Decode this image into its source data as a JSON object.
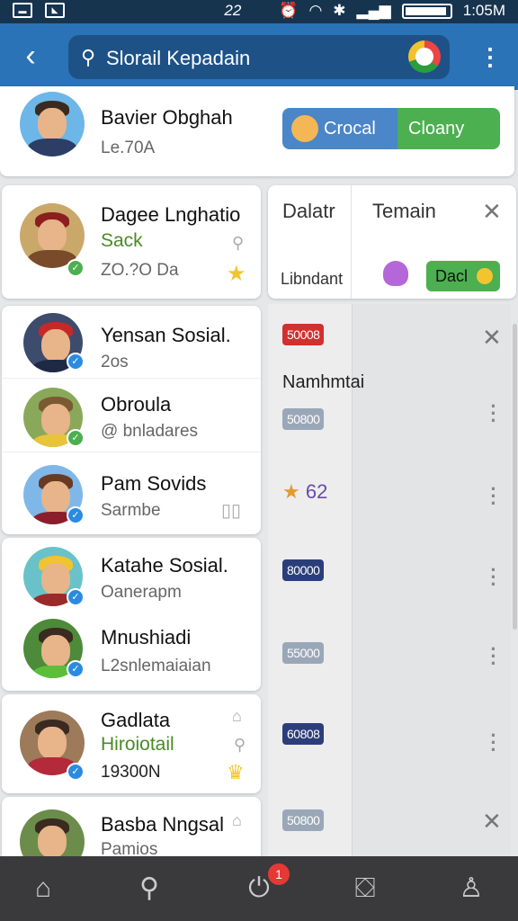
{
  "status": {
    "time": "1:05M",
    "left_label": "22"
  },
  "appbar": {
    "search_text": "Slorail Kepadain"
  },
  "top_card": {
    "name": "Bavier Obghah",
    "sub": "Le.70A",
    "btn_primary": "Crocal",
    "btn_secondary": "Cloany"
  },
  "side_header": {
    "tab1": "Dalatr",
    "tab2": "Temain",
    "label": "Libndant",
    "action": "Dacl"
  },
  "side_title": "Namhmtai",
  "featured": {
    "name": "Dagee Lnghatio",
    "sub_green": "Sack",
    "meta": "ZO.?O Da"
  },
  "contacts": [
    {
      "name": "Yensan Sosial.",
      "sub": "2os",
      "value": "50008"
    },
    {
      "name": "Obroula",
      "sub": "@ bnladares",
      "value": "50800"
    },
    {
      "name": "Pam Sovids",
      "sub": "Sarmbe",
      "value": "62"
    },
    {
      "name": "Katahe Sosial.",
      "sub": "Oanerapm",
      "value": "80000"
    },
    {
      "name": "Mnushiadi",
      "sub": "L2snlemaiaian",
      "value": "55000"
    },
    {
      "name": "Gadlata",
      "sub_green": "Hiroiotail",
      "meta": "19300N",
      "value": "60808"
    },
    {
      "name": "Basba Nngsal",
      "sub": "Pamios",
      "value": "50800"
    }
  ],
  "colors": {
    "appbar": "#2b73b7",
    "statusbar": "#17344f",
    "accent_green": "#4caf50",
    "accent_blue": "#4a86c8",
    "navbar": "#3a3a3c"
  },
  "nav": {
    "badge": "1",
    "items": [
      "home-icon",
      "search-icon",
      "power-icon",
      "inbox-icon",
      "person-icon"
    ]
  }
}
